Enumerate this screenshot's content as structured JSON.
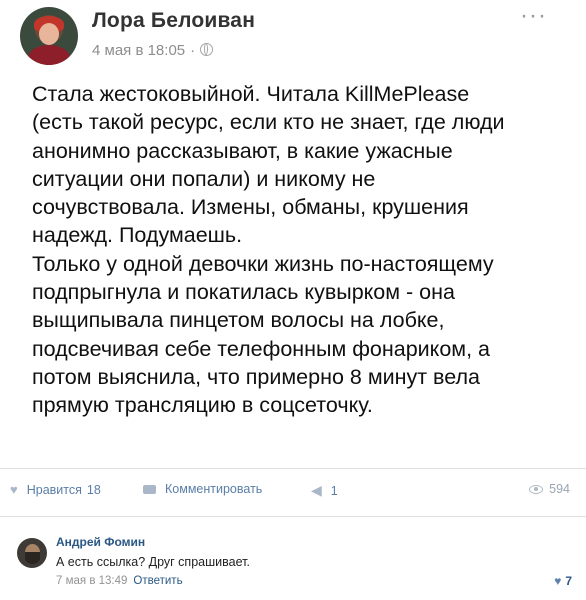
{
  "post": {
    "author": "Лора Белоиван",
    "date": "4 мая в 18:05",
    "meta_separator": "·",
    "text": "Стала жестоковыйной. Читала KillMePlease\n(есть такой ресурс, если кто не знает, где люди\nанонимно рассказывают, в какие ужасные\nситуации они попали) и никому не\nсочувствовала. Измены, обманы, крушения\nнадежд. Подумаешь.\nТолько у одной девочки жизнь по-настоящему\nподпрыгнула и покатилась кувырком - она\nвыщипывала пинцетом волосы на лобке,\nподсвечивая себе телефонным фонариком, а\nпотом выяснила, что примерно 8 минут вела\nпрямую трансляцию в соцсеточку.",
    "more": "···"
  },
  "actions": {
    "like_label": "Нравится",
    "like_count": "18",
    "comment_label": "Комментировать",
    "share_count": "1",
    "views": "594"
  },
  "comment": {
    "author": "Андрей Фомин",
    "text": "А есть ссылка? Друг спрашивает.",
    "date": "7 мая в 13:49",
    "reply_label": "Ответить",
    "like_count": "7"
  },
  "icons": {
    "globe": "globe-icon",
    "more": "more-icon",
    "like": "heart-icon",
    "comment": "comment-icon",
    "share": "megaphone-icon",
    "views": "eye-icon"
  },
  "colors": {
    "link": "#2a5885",
    "action": "#5a7ea8",
    "meta": "#8d8d8d",
    "divider": "#e1e1e1"
  }
}
